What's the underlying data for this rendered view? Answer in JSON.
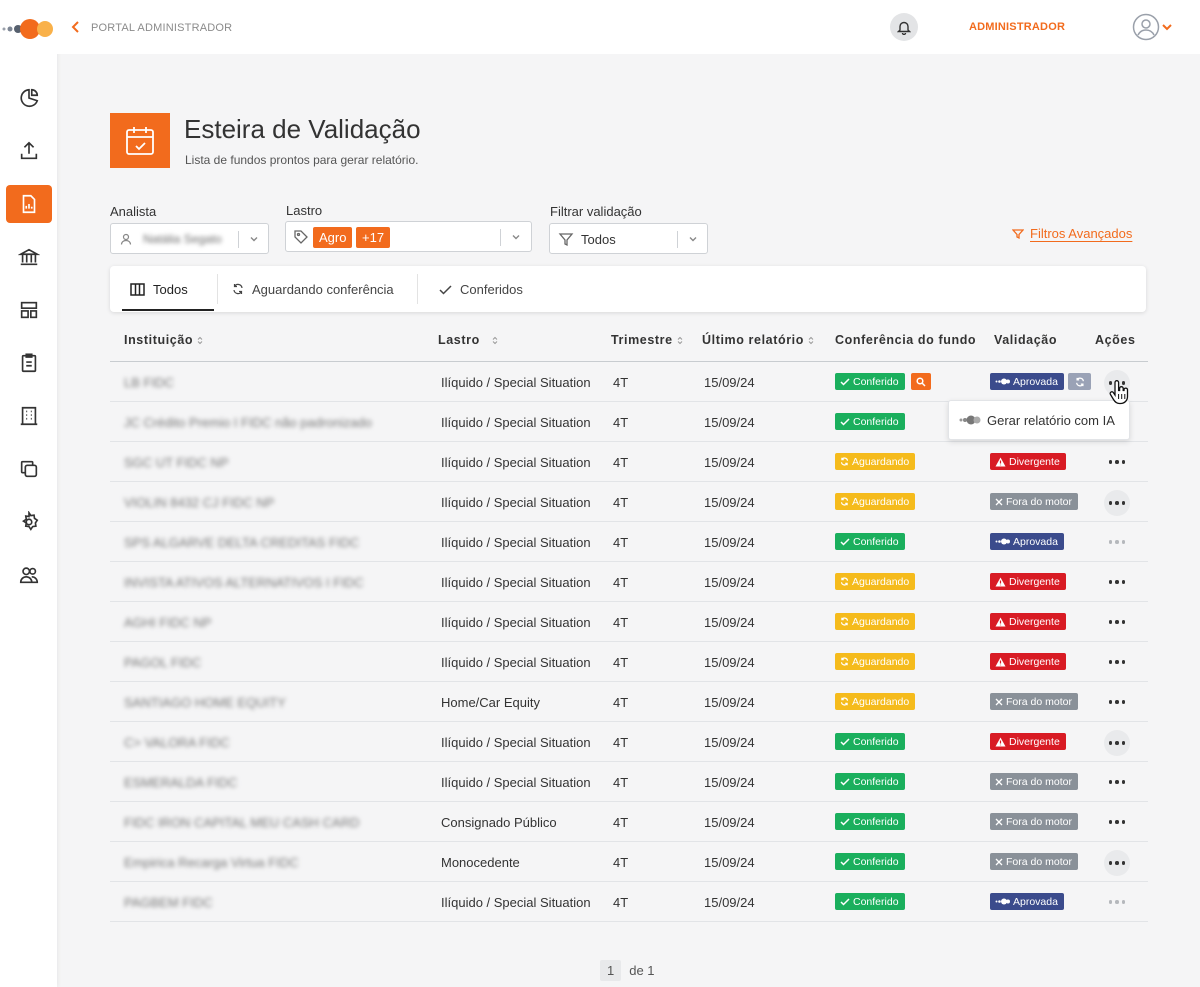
{
  "topbar": {
    "breadcrumb": "PORTAL ADMINISTRADOR",
    "user_label": "ADMINISTRADOR"
  },
  "sidebar": {
    "items": [
      {
        "icon": "pie-chart-icon"
      },
      {
        "icon": "upload-icon"
      },
      {
        "icon": "report-icon",
        "active": true
      },
      {
        "icon": "bank-icon"
      },
      {
        "icon": "layout-icon"
      },
      {
        "icon": "clipboard-icon"
      },
      {
        "icon": "building-icon"
      },
      {
        "icon": "copy-icon"
      },
      {
        "icon": "settings-icon"
      },
      {
        "icon": "users-icon"
      }
    ]
  },
  "page": {
    "title": "Esteira de Validação",
    "subtitle": "Lista de fundos prontos para gerar relatório."
  },
  "filters": {
    "analista_label": "Analista",
    "analista_value": "Natália Segato",
    "lastro_label": "Lastro",
    "lastro_tag": "Agro",
    "lastro_more": "+17",
    "validacao_label": "Filtrar validação",
    "validacao_value": "Todos",
    "advanced": "Filtros Avançados"
  },
  "tabs": {
    "todos": "Todos",
    "aguardando": "Aguardando conferência",
    "conferidos": "Conferidos"
  },
  "table": {
    "headers": {
      "instituicao": "Instituição",
      "lastro": "Lastro",
      "trimestre": "Trimestre",
      "ultimo": "Último relatório",
      "conferencia": "Conferência do fundo",
      "validacao": "Validação",
      "acoes": "Ações"
    },
    "rows": [
      {
        "inst": "LB FIDC",
        "lastro": "Ilíquido / Special Situation",
        "tri": "4T",
        "date": "15/09/24",
        "conf": "Conferido",
        "val": "Aprovada"
      },
      {
        "inst": "JC Crédito Premio I FIDC não padronizado",
        "lastro": "Ilíquido / Special Situation",
        "tri": "4T",
        "date": "15/09/24",
        "conf": "Conferido",
        "val": ""
      },
      {
        "inst": "SGC UT FIDC NP",
        "lastro": "Ilíquido / Special Situation",
        "tri": "4T",
        "date": "15/09/24",
        "conf": "Aguardando",
        "val": "Divergente"
      },
      {
        "inst": "VIOLIN 8432 CJ FIDC NP",
        "lastro": "Ilíquido / Special Situation",
        "tri": "4T",
        "date": "15/09/24",
        "conf": "Aguardando",
        "val": "Fora do motor"
      },
      {
        "inst": "SPS ALGARVE DELTA CREDITAS FIDC",
        "lastro": "Ilíquido / Special Situation",
        "tri": "4T",
        "date": "15/09/24",
        "conf": "Conferido",
        "val": "Aprovada"
      },
      {
        "inst": "INVISTA ATIVOS ALTERNATIVOS I FIDC",
        "lastro": "Ilíquido / Special Situation",
        "tri": "4T",
        "date": "15/09/24",
        "conf": "Aguardando",
        "val": "Divergente"
      },
      {
        "inst": "AGHI FIDC NP",
        "lastro": "Ilíquido / Special Situation",
        "tri": "4T",
        "date": "15/09/24",
        "conf": "Aguardando",
        "val": "Divergente"
      },
      {
        "inst": "PAGOL FIDC",
        "lastro": "Ilíquido / Special Situation",
        "tri": "4T",
        "date": "15/09/24",
        "conf": "Aguardando",
        "val": "Divergente"
      },
      {
        "inst": "SANTIAGO HOME EQUITY",
        "lastro": "Home/Car Equity",
        "tri": "4T",
        "date": "15/09/24",
        "conf": "Aguardando",
        "val": "Fora do motor"
      },
      {
        "inst": "C> VALORA FIDC",
        "lastro": "Ilíquido / Special Situation",
        "tri": "4T",
        "date": "15/09/24",
        "conf": "Conferido",
        "val": "Divergente"
      },
      {
        "inst": "ESMERALDA FIDC",
        "lastro": "Ilíquido / Special Situation",
        "tri": "4T",
        "date": "15/09/24",
        "conf": "Conferido",
        "val": "Fora do motor"
      },
      {
        "inst": "FIDC IRON CAPITAL MEU CASH CARD",
        "lastro": "Consignado Público",
        "tri": "4T",
        "date": "15/09/24",
        "conf": "Conferido",
        "val": "Fora do motor"
      },
      {
        "inst": "Empirica Recarga Virtua FIDC",
        "lastro": "Monocedente",
        "tri": "4T",
        "date": "15/09/24",
        "conf": "Conferido",
        "val": "Fora do motor"
      },
      {
        "inst": "PAGBEM FIDC",
        "lastro": "Ilíquido / Special Situation",
        "tri": "4T",
        "date": "15/09/24",
        "conf": "Conferido",
        "val": "Aprovada"
      }
    ]
  },
  "dropdown": {
    "item": "Gerar relatório com IA"
  },
  "pagination": {
    "current": "1",
    "total": "de 1"
  },
  "colors": {
    "accent": "#f26b1d",
    "conferido": "#1aaf5d",
    "aguardando": "#f5bb1c",
    "aprovada": "#3b4b8c",
    "divergente": "#d81b24",
    "fora": "#8a9199"
  }
}
